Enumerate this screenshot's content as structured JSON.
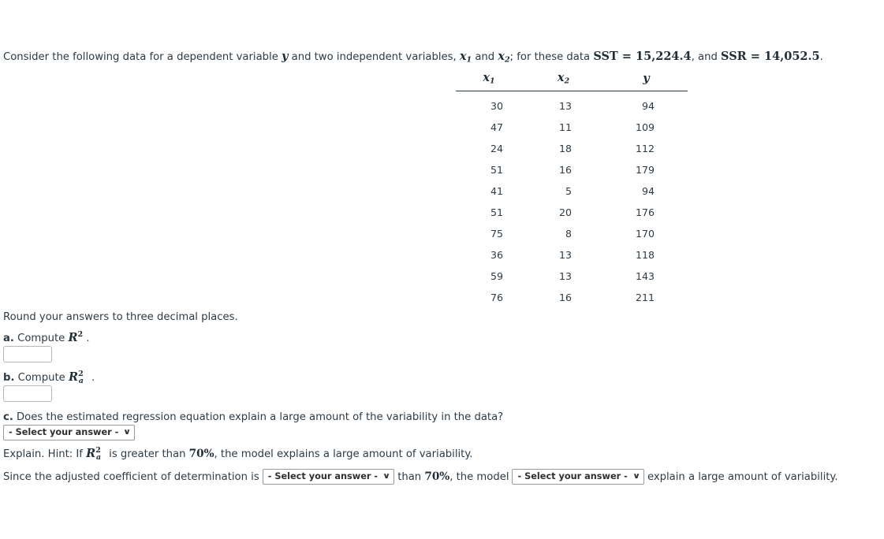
{
  "intro": {
    "part1": "Consider the following data for a dependent variable ",
    "var_y": "y",
    "part2": " and two independent variables, ",
    "var_x1": "x",
    "var_x1_sub": "1",
    "part3": " and ",
    "var_x2": "x",
    "var_x2_sub": "2",
    "part4": "; for these data ",
    "sst_label": "SST",
    "eq": "=",
    "sst_value": "15,224.4",
    "part5": ", and ",
    "ssr_label": "SSR",
    "ssr_value": "14,052.5",
    "part6": "."
  },
  "table": {
    "headers": [
      "x1",
      "x2",
      "y"
    ],
    "header_glyphs": {
      "c1_base": "x",
      "c1_sub": "1",
      "c2_base": "x",
      "c2_sub": "2",
      "c3_base": "y"
    },
    "rows": [
      {
        "x1": "30",
        "x2": "13",
        "y": "94"
      },
      {
        "x1": "47",
        "x2": "11",
        "y": "109"
      },
      {
        "x1": "24",
        "x2": "18",
        "y": "112"
      },
      {
        "x1": "51",
        "x2": "16",
        "y": "179"
      },
      {
        "x1": "41",
        "x2": "5",
        "y": "94"
      },
      {
        "x1": "51",
        "x2": "20",
        "y": "176"
      },
      {
        "x1": "75",
        "x2": "8",
        "y": "170"
      },
      {
        "x1": "36",
        "x2": "13",
        "y": "118"
      },
      {
        "x1": "59",
        "x2": "13",
        "y": "143"
      },
      {
        "x1": "76",
        "x2": "16",
        "y": "211"
      }
    ]
  },
  "prompts": {
    "round_note": "Round your answers to three decimal places.",
    "a_label": "a.",
    "a_text": "Compute",
    "a_math_base": "R",
    "a_math_sup": "2",
    "a_period": ".",
    "b_label": "b.",
    "b_text": "Compute",
    "b_math_base": "R",
    "b_math_sup": "2",
    "b_math_sub": "a",
    "b_period": ".",
    "c_label": "c.",
    "c_text": "Does the estimated regression equation explain a large amount of the variability in the data?"
  },
  "inputs": {
    "answer_a": "",
    "answer_b": "",
    "answer_placeholder": ""
  },
  "selects": {
    "placeholder": "- Select your answer -",
    "chevron": "∨",
    "c_answer": "- Select your answer -",
    "comparison": "- Select your answer -",
    "model_does": "- Select your answer -"
  },
  "explain": {
    "prefix": "Explain. Hint: If ",
    "math_base": "R",
    "math_sup": "2",
    "math_sub": "a",
    "mid": " is greater than ",
    "pct": "70%",
    "suffix": ", the model explains a large amount of variability."
  },
  "since": {
    "prefix": "Since the adjusted coefficient of determination is",
    "mid": "than",
    "pct": "70%",
    "mid2": ", the model",
    "suffix": "explain a large amount of variability."
  },
  "colors": {
    "text": "#2d3b45",
    "math": "#1f2d36",
    "rule": "#2d3b45",
    "input_border": "#b7b7b7",
    "select_border": "#9b9b9b"
  }
}
